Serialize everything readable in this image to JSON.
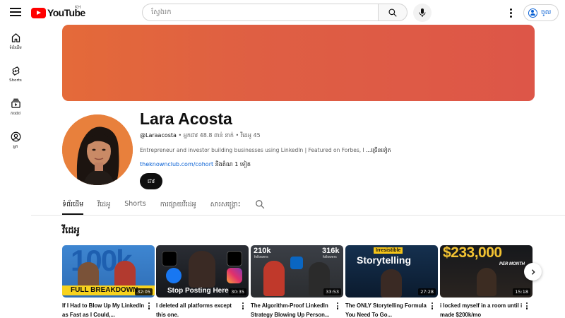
{
  "header": {
    "logo_text": "YouTube",
    "country_code": "KH",
    "search_placeholder": "ស្វែងរក",
    "signin_label": "ចូល"
  },
  "sidebar": {
    "items": [
      {
        "label": "ទំព័រដើម",
        "icon": "home-icon"
      },
      {
        "label": "Shorts",
        "icon": "shorts-icon"
      },
      {
        "label": "ការជាវ",
        "icon": "subscriptions-icon"
      },
      {
        "label": "អ្នក",
        "icon": "you-icon"
      }
    ]
  },
  "channel": {
    "banner_color": "#e0603f",
    "name": "Lara Acosta",
    "handle": "@Laraacosta",
    "meta_rest": " • អ្នកជាវ 48.8 ពាន់ នាក់ • វីដេអូ 45",
    "description": "Entrepreneur and investor building businesses using LinkedIn | Featured on Forbes, I",
    "description_more": " ...ច្រើនទៀត",
    "link_url_text": "theknownclub.com/cohort",
    "link_more": " និងតំណ 1 ទៀត",
    "subscribe_label": "ជាវ"
  },
  "tabs": [
    {
      "label": "ទំព័រដើម",
      "active": true
    },
    {
      "label": "វីដេអូ",
      "active": false
    },
    {
      "label": "Shorts",
      "active": false
    },
    {
      "label": "ការផ្សាយវីដេអូ",
      "active": false
    },
    {
      "label": "សារសង្គ្រោះ",
      "active": false
    }
  ],
  "section_title": "វីដេអូ",
  "videos": [
    {
      "title": "If I Had to Blow Up My LinkedIn as Fast as I Could,...",
      "duration": "32:05",
      "thumb_text": "100k",
      "thumb_caption": "FULL BREAKDOWN"
    },
    {
      "title": "I deleted all platforms except this one.",
      "duration": "30:35",
      "thumb_caption": "Stop Posting Here"
    },
    {
      "title": "The Algorithm-Proof LinkedIn Strategy Blowing Up Person...",
      "duration": "33:53",
      "thumb_left_stat": "210k",
      "thumb_left_sub": "followers",
      "thumb_right_stat": "316k",
      "thumb_right_sub": "followers"
    },
    {
      "title": "The ONLY Storytelling Formula You Need To Go...",
      "duration": "27:28",
      "thumb_tag": "Irresistible",
      "thumb_caption": "Storytelling"
    },
    {
      "title": "i locked myself in a room until i made $200k/mo",
      "duration": "15:18",
      "thumb_text": "$233,000",
      "thumb_caption": "PER MONTH"
    }
  ]
}
